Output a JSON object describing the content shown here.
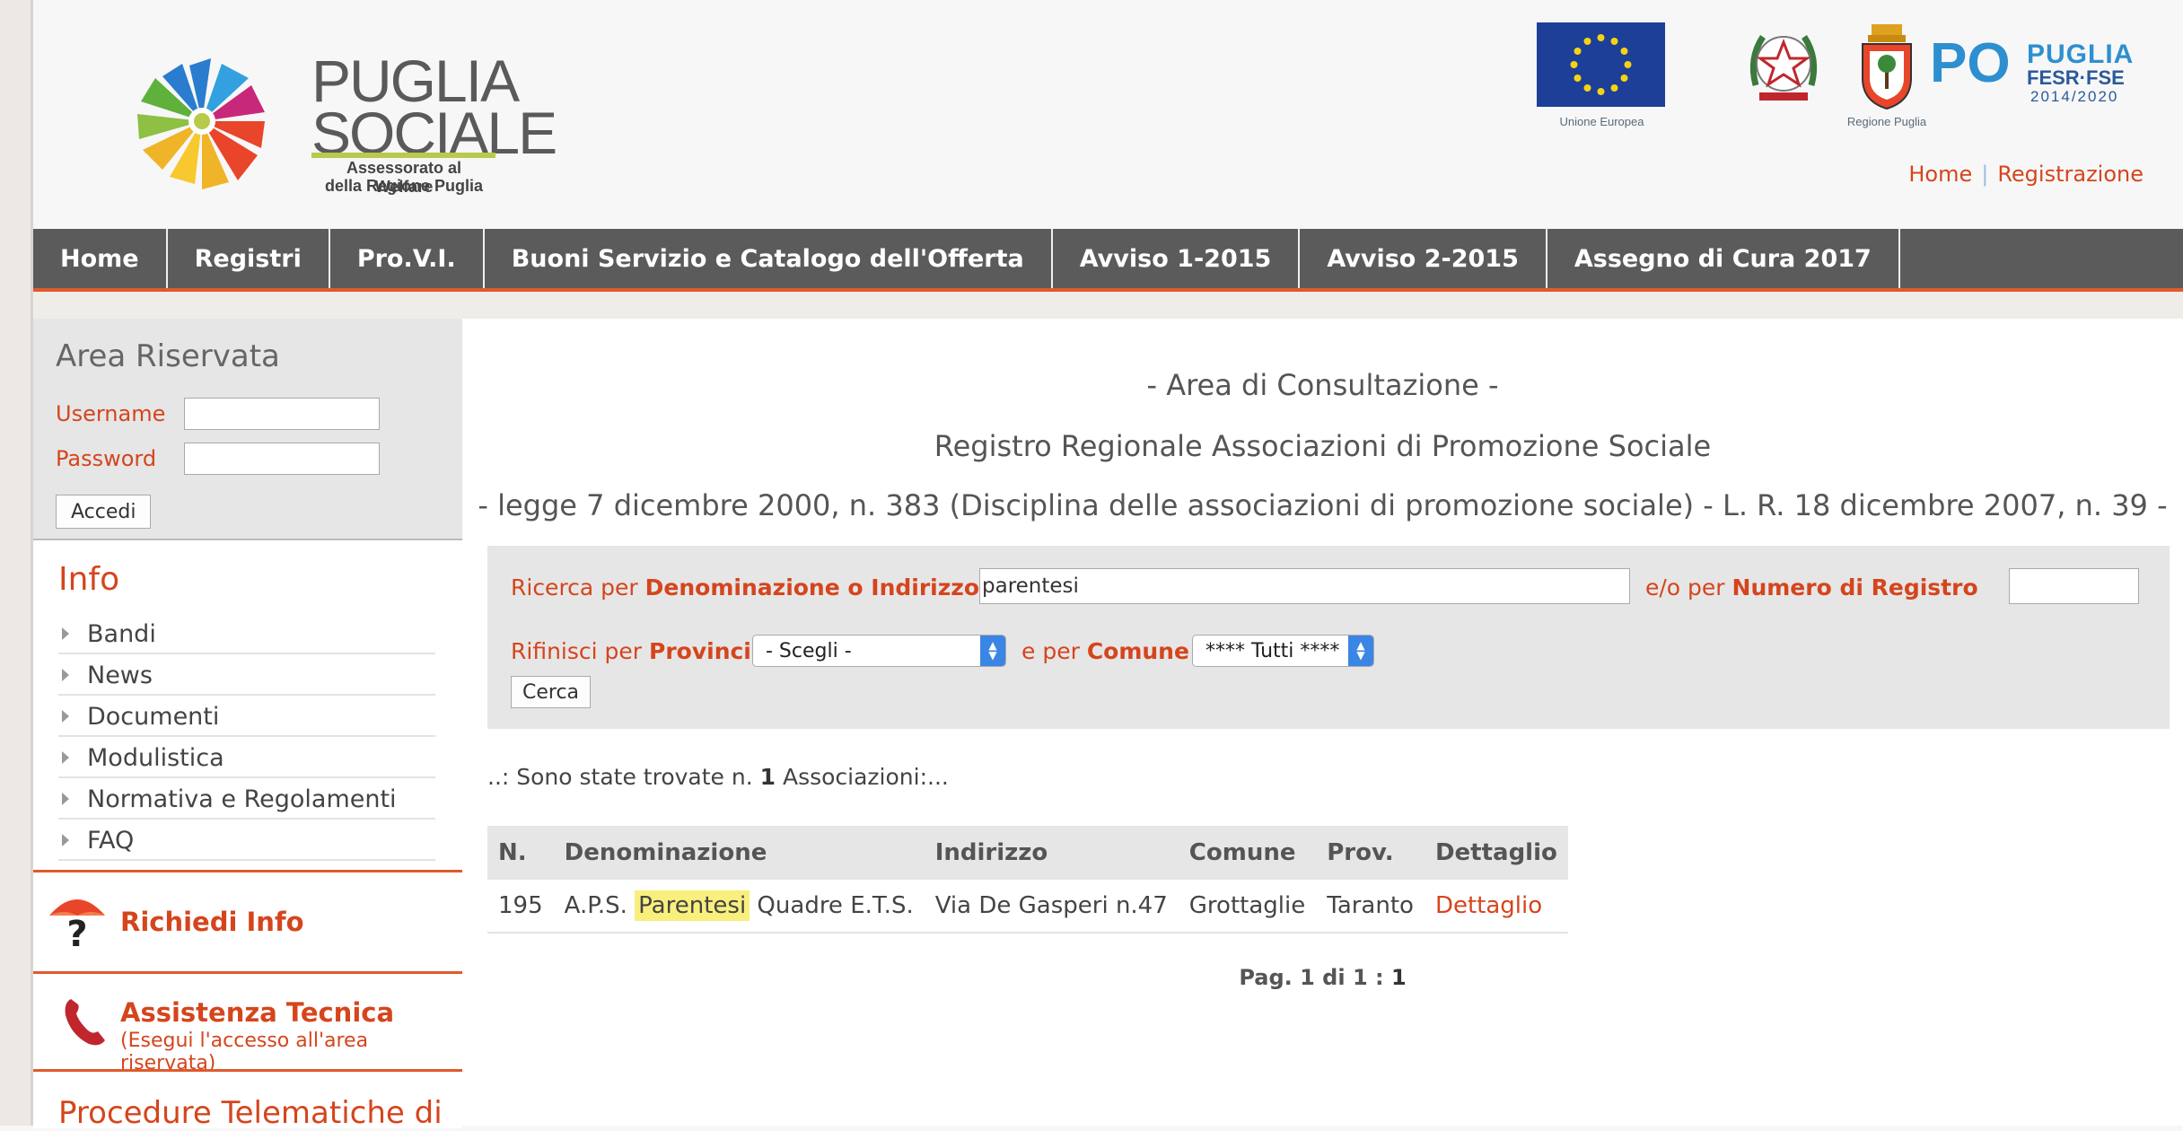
{
  "brand": {
    "title_line1": "PUGLIA",
    "title_line2": "SOCIALE",
    "subtitle_line1": "Assessorato al Welfare",
    "subtitle_line2": "della Regione Puglia"
  },
  "partners": {
    "eu_label": "Unione Europea",
    "region_label": "Regione Puglia",
    "po_mark": "PO",
    "po_title": "PUGLIA",
    "po_fund": "FESR·FSE",
    "po_years": "2014/2020"
  },
  "top_links": {
    "home": "Home",
    "register": "Registrazione"
  },
  "nav": {
    "items": [
      {
        "label": "Home"
      },
      {
        "label": "Registri"
      },
      {
        "label": "Pro.V.I."
      },
      {
        "label": "Buoni Servizio e Catalogo dell'Offerta"
      },
      {
        "label": "Avviso 1-2015"
      },
      {
        "label": "Avviso 2-2015"
      },
      {
        "label": "Assegno di Cura 2017"
      }
    ]
  },
  "login": {
    "title": "Area Riservata",
    "username_label": "Username",
    "password_label": "Password",
    "username_value": "",
    "password_value": "",
    "submit_label": "Accedi"
  },
  "info": {
    "title": "Info",
    "items": [
      {
        "label": "Bandi"
      },
      {
        "label": "News"
      },
      {
        "label": "Documenti"
      },
      {
        "label": "Modulistica"
      },
      {
        "label": "Normativa e Regolamenti"
      },
      {
        "label": "FAQ"
      }
    ]
  },
  "side_boxes": {
    "request_info": "Richiedi Info",
    "tech_support": "Assistenza Tecnica",
    "tech_support_note": "(Esegui l'accesso all'area riservata)",
    "procedures": "Procedure Telematiche di"
  },
  "main": {
    "heading1": "- Area di Consultazione -",
    "heading2": "Registro Regionale Associazioni di Promozione Sociale",
    "heading3": "- legge 7 dicembre 2000, n. 383 (Disciplina delle associazioni di promozione sociale) - L. R. 18 dicembre 2007, n. 39 -"
  },
  "search": {
    "label_prefix": "Ricerca per ",
    "label_bold": "Denominazione o Indirizzo",
    "query_value": "parentesi",
    "registry_prefix": "e/o per ",
    "registry_bold": "Numero di Registro",
    "registry_value": "",
    "refine_prefix": "Rifinisci per ",
    "refine_bold": "Provincia",
    "province_selected": "- Scegli -",
    "comune_prefix": "e per ",
    "comune_bold": "Comune",
    "comune_selected": "**** Tutti ****",
    "submit_label": "Cerca"
  },
  "results": {
    "count_prefix": "..: Sono state trovate n. ",
    "count": "1",
    "count_suffix": " Associazioni:...",
    "columns": [
      "N.",
      "Denominazione",
      "Indirizzo",
      "Comune",
      "Prov.",
      "Dettaglio"
    ],
    "rows": [
      {
        "number": "195",
        "name_before": "A.P.S. ",
        "name_highlight": "Parentesi",
        "name_after": " Quadre E.T.S.",
        "address": "Via De Gasperi n.47",
        "comune": "Grottaglie",
        "prov": "Taranto",
        "detail": "Dettaglio"
      }
    ]
  },
  "pager": {
    "prefix": "Pag. 1 di 1 : ",
    "current": "1"
  },
  "colors": {
    "accent": "#d5451d",
    "nav_bg": "#5b5b5b",
    "nav_border": "#e05a2c",
    "panel_bg": "#e6e6e6",
    "highlight": "#f9ef7c",
    "eu_blue": "#1d3f98",
    "po_blue": "#2e8fd0"
  }
}
